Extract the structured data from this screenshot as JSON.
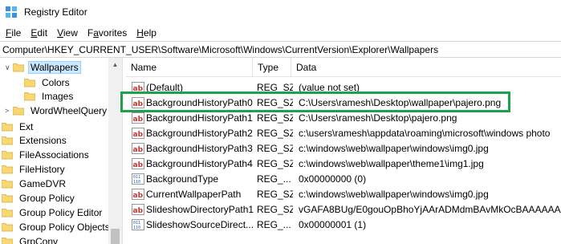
{
  "window": {
    "title": "Registry Editor"
  },
  "menu": {
    "items": [
      {
        "label": "File",
        "accel": "F",
        "rest": "ile"
      },
      {
        "label": "Edit",
        "accel": "E",
        "rest": "dit"
      },
      {
        "label": "View",
        "accel": "V",
        "rest": "iew"
      },
      {
        "label": "Favorites",
        "accel": "a",
        "pre": "F",
        "rest": "vorites"
      },
      {
        "label": "Help",
        "accel": "H",
        "rest": "elp"
      }
    ]
  },
  "address": {
    "path": "Computer\\HKEY_CURRENT_USER\\Software\\Microsoft\\Windows\\CurrentVersion\\Explorer\\Wallpapers"
  },
  "tree": {
    "items": [
      {
        "label": "Wallpapers",
        "level": 1,
        "selected": true,
        "expander": "∨"
      },
      {
        "label": "Colors",
        "level": 2
      },
      {
        "label": "Images",
        "level": 2
      },
      {
        "label": "WordWheelQuery",
        "level": 1,
        "expander": ">"
      },
      {
        "label": "Ext",
        "level": 0
      },
      {
        "label": "Extensions",
        "level": 0
      },
      {
        "label": "FileAssociations",
        "level": 0
      },
      {
        "label": "FileHistory",
        "level": 0
      },
      {
        "label": "GameDVR",
        "level": 0
      },
      {
        "label": "Group Policy",
        "level": 0
      },
      {
        "label": "Group Policy Editor",
        "level": 0
      },
      {
        "label": "Group Policy Objects",
        "level": 0
      },
      {
        "label": "GrpConv",
        "level": 0
      }
    ]
  },
  "list": {
    "columns": [
      "Name",
      "Type",
      "Data"
    ],
    "rows": [
      {
        "name": "(Default)",
        "type": "REG_SZ",
        "data": "(value not set)",
        "icon": "string-value-icon"
      },
      {
        "name": "BackgroundHistoryPath0",
        "type": "REG_SZ",
        "data": "C:\\Users\\ramesh\\Desktop\\wallpaper\\pajero.png",
        "icon": "string-value-icon"
      },
      {
        "name": "BackgroundHistoryPath1",
        "type": "REG_SZ",
        "data": "C:\\Users\\ramesh\\Desktop\\pajero.png",
        "icon": "string-value-icon"
      },
      {
        "name": "BackgroundHistoryPath2",
        "type": "REG_SZ",
        "data": "c:\\users\\ramesh\\appdata\\roaming\\microsoft\\windows photo",
        "icon": "string-value-icon"
      },
      {
        "name": "BackgroundHistoryPath3",
        "type": "REG_SZ",
        "data": "c:\\windows\\web\\wallpaper\\windows\\img0.jpg",
        "icon": "string-value-icon"
      },
      {
        "name": "BackgroundHistoryPath4",
        "type": "REG_SZ",
        "data": "c:\\windows\\web\\wallpaper\\theme1\\img1.jpg",
        "icon": "string-value-icon"
      },
      {
        "name": "BackgroundType",
        "type": "REG_...",
        "data": "0x00000000 (0)",
        "icon": "binary-value-icon"
      },
      {
        "name": "CurrentWallpaperPath",
        "type": "REG_SZ",
        "data": "c:\\windows\\web\\wallpaper\\windows\\img0.jpg",
        "icon": "string-value-icon"
      },
      {
        "name": "SlideshowDirectoryPath1",
        "type": "REG_SZ",
        "data": "vGAFA8BUg/E0gouOpBhoYjAArADMdmBAvMkOcBAAAAAAA",
        "icon": "string-value-icon"
      },
      {
        "name": "SlideshowSourceDirect...",
        "type": "REG_...",
        "data": "0x00000001 (1)",
        "icon": "binary-value-icon"
      }
    ]
  },
  "colors": {
    "highlight": "#1fa04a",
    "selection": "#cce8ff",
    "folder": "#f8d775"
  }
}
